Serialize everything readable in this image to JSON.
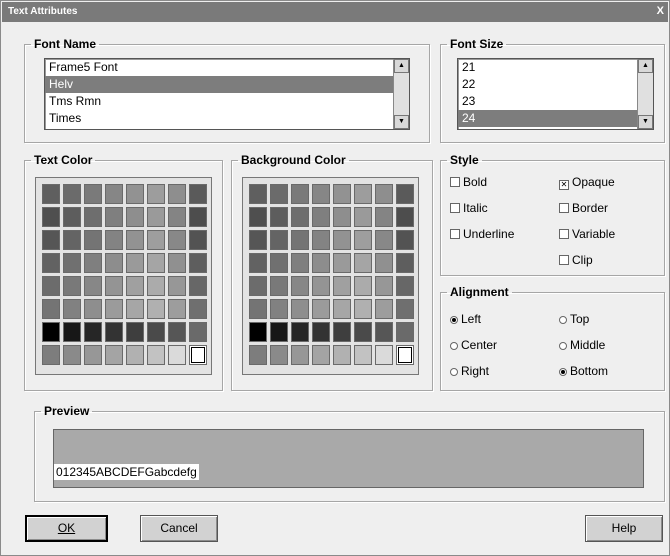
{
  "window": {
    "title": "Text Attributes",
    "close_glyph": "X"
  },
  "font_name": {
    "legend": "Font Name",
    "items": [
      "Frame5 Font",
      "Helv",
      "Tms Rmn",
      "Times"
    ],
    "selected_index": 1
  },
  "font_size": {
    "legend": "Font Size",
    "items": [
      "21",
      "22",
      "23",
      "24"
    ],
    "selected_index": 3
  },
  "text_color": {
    "legend": "Text Color",
    "selected": "row 8, column 8"
  },
  "background_color": {
    "legend": "Background Color",
    "selected": "row 8, column 8"
  },
  "palette": {
    "rows": [
      [
        "#5f5f5f",
        "#6b6b6b",
        "#7a7a7a",
        "#868686",
        "#929292",
        "#9d9d9d",
        "#8e8e8e",
        "#5a5a5a"
      ],
      [
        "#4f4f4f",
        "#5d5d5d",
        "#6e6e6e",
        "#7f7f7f",
        "#8e8e8e",
        "#9a9a9a",
        "#848484",
        "#4d4d4d"
      ],
      [
        "#565656",
        "#646464",
        "#747474",
        "#838383",
        "#929292",
        "#9e9e9e",
        "#888888",
        "#535353"
      ],
      [
        "#626262",
        "#707070",
        "#7f7f7f",
        "#8d8d8d",
        "#9a9a9a",
        "#a5a5a5",
        "#909090",
        "#5e5e5e"
      ],
      [
        "#6c6c6c",
        "#797979",
        "#878787",
        "#949494",
        "#a0a0a0",
        "#ababab",
        "#979797",
        "#676767"
      ],
      [
        "#747474",
        "#818181",
        "#8e8e8e",
        "#9b9b9b",
        "#a6a6a6",
        "#b0b0b0",
        "#9d9d9d",
        "#6f6f6f"
      ],
      [
        "#000000",
        "#171717",
        "#262626",
        "#333333",
        "#3e3e3e",
        "#4a4a4a",
        "#565656",
        "#6a6a6a"
      ],
      [
        "#7d7d7d",
        "#8a8a8a",
        "#979797",
        "#a4a4a4",
        "#b1b1b1",
        "#c2c2c2",
        "#dadada",
        "#ffffff"
      ]
    ]
  },
  "style": {
    "legend": "Style",
    "bold": {
      "label": "Bold",
      "checked": false
    },
    "italic": {
      "label": "Italic",
      "checked": false
    },
    "underline": {
      "label": "Underline",
      "checked": false
    },
    "opaque": {
      "label": "Opaque",
      "checked": true
    },
    "border": {
      "label": "Border",
      "checked": false
    },
    "variable": {
      "label": "Variable",
      "checked": false
    },
    "clip": {
      "label": "Clip",
      "checked": false
    }
  },
  "alignment": {
    "legend": "Alignment",
    "left": {
      "label": "Left",
      "selected": true
    },
    "center": {
      "label": "Center",
      "selected": false
    },
    "right": {
      "label": "Right",
      "selected": false
    },
    "top": {
      "label": "Top",
      "selected": false
    },
    "middle": {
      "label": "Middle",
      "selected": false
    },
    "bottom": {
      "label": "Bottom",
      "selected": true
    }
  },
  "preview": {
    "legend": "Preview",
    "sample": "012345ABCDEFGabcdefg"
  },
  "buttons": {
    "ok": "OK",
    "cancel": "Cancel",
    "help": "Help"
  }
}
